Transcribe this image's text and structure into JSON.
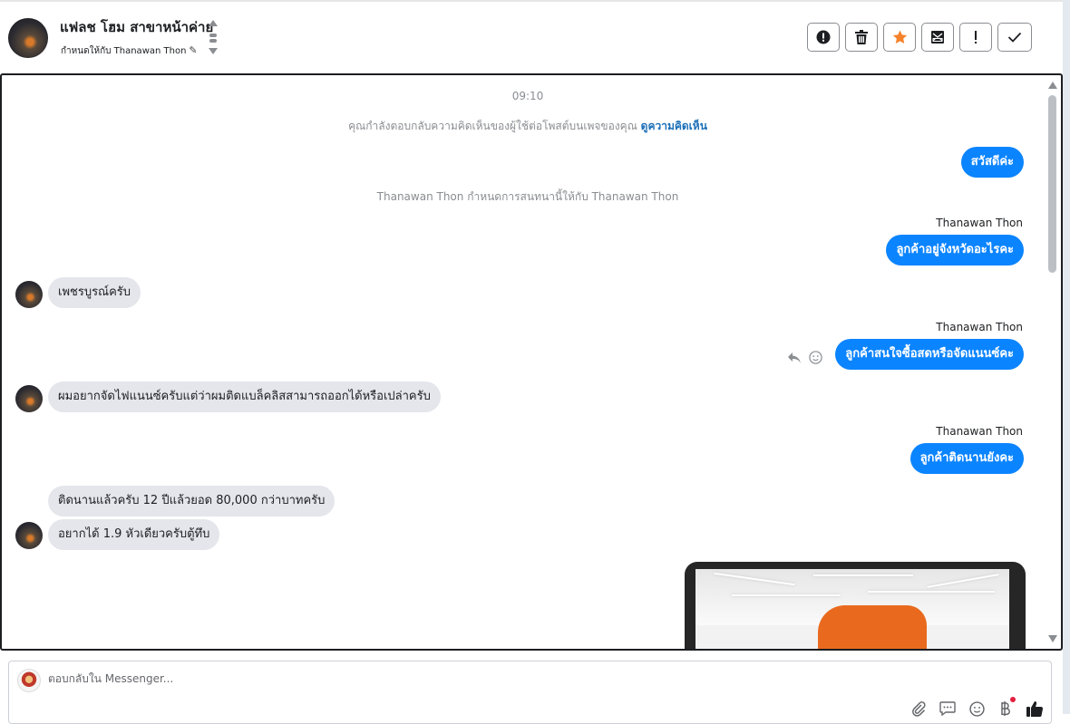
{
  "header": {
    "title": "แฟลช โฮม สาขาหน้าค่าย",
    "assigned_text": "กำหนดให้กับ Thanawan Thon"
  },
  "toolbar": {
    "icons": [
      "alert-circle-icon",
      "trash-icon",
      "star-icon",
      "mark-unread-icon",
      "exclamation-icon",
      "check-icon"
    ],
    "star_color": "#f5822a"
  },
  "chat": {
    "timestamp": "09:10",
    "notice_text": "คุณกำลังตอบกลับความคิดเห็นของผู้ใช้ต่อโพสต์บนเพจของคุณ ",
    "notice_link": "ดูความคิดเห็น",
    "system_message": "Thanawan Thon กำหนดการสนทนานี้ให้กับ Thanawan Thon",
    "messages": [
      {
        "direction": "out",
        "sender": "",
        "text": "สวัสดีค่ะ"
      },
      {
        "direction": "out",
        "sender": "Thanawan Thon",
        "text": "ลูกค้าอยู่จังหวัดอะไรคะ"
      },
      {
        "direction": "in",
        "text": "เพชรบูรณ์ครับ"
      },
      {
        "direction": "out",
        "sender": "Thanawan Thon",
        "text": "ลูกค้าสนใจซื้อสดหรือจัดแนนซ์คะ"
      },
      {
        "direction": "in",
        "text": "ผมอยากจัดไฟแนนซ์ครับแต่ว่าผมติดแบล็คลิสสามารถออกได้หรือเปล่าครับ"
      },
      {
        "direction": "out",
        "sender": "Thanawan Thon",
        "text": "ลูกค้าติดนานยังคะ"
      },
      {
        "direction": "in",
        "text": "ติดนานแล้วครับ 12 ปีแล้วยอด 80,000 กว่าบาทครับ"
      },
      {
        "direction": "in",
        "text": "อยากได้ 1.9 หัวเดียวครับตู้ทึบ"
      }
    ]
  },
  "reply": {
    "placeholder": "ตอบกลับใน Messenger..."
  },
  "colors": {
    "outgoing_bubble": "#0b84ff",
    "incoming_bubble": "#e4e6eb",
    "link": "#1b6fb8"
  }
}
